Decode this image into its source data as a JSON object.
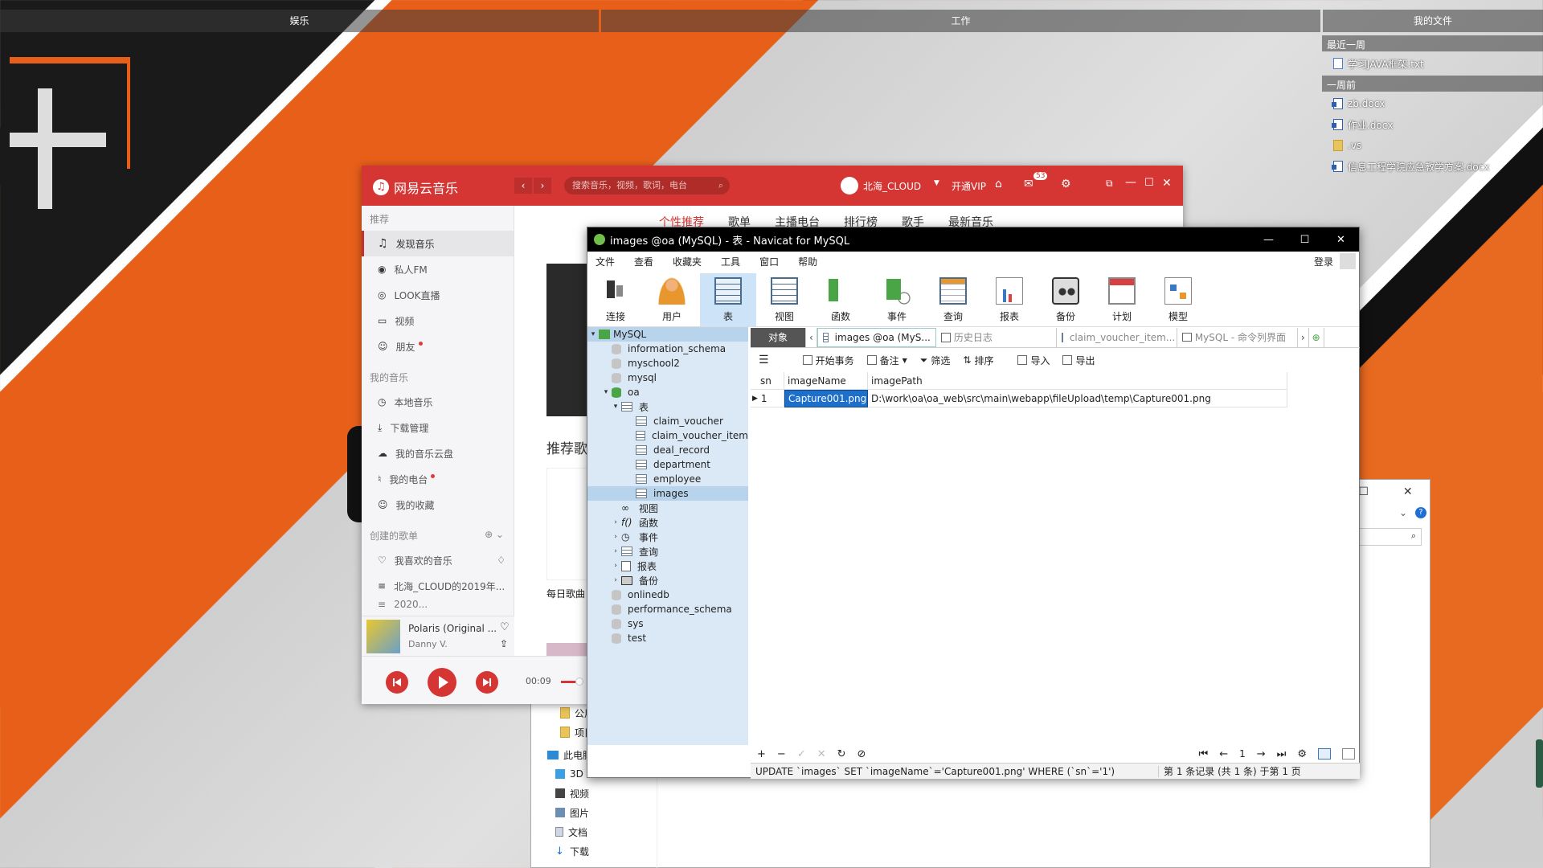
{
  "desktop": {
    "fences": [
      "娱乐",
      "工作",
      "我的文件"
    ],
    "recent": {
      "header1": "最近一周",
      "items1": [
        "学习JAVA框架.txt"
      ],
      "header2": "一周前",
      "items2": [
        "zb.docx",
        "作业.docx",
        ".vs",
        "信息工程学院应急教学方案.docx"
      ]
    }
  },
  "explorer": {
    "items": [
      "公用",
      "项目",
      "此电脑",
      "3D",
      "视频",
      "图片",
      "文档",
      "下载"
    ]
  },
  "netease": {
    "brand": "网易云音乐",
    "search_placeholder": "搜索音乐，视频，歌词，电台",
    "user": "北海_CLOUD",
    "vip": "开通VIP",
    "mail_count": "53",
    "tabs": [
      "个性推荐",
      "歌单",
      "主播电台",
      "排行榜",
      "歌手",
      "最新音乐"
    ],
    "sec_recommend": "推荐",
    "recommend_items": [
      "发现音乐",
      "私人FM",
      "LOOK直播",
      "视频",
      "朋友"
    ],
    "sec_mine": "我的音乐",
    "mine_items": [
      "本地音乐",
      "下载管理",
      "我的音乐云盘",
      "我的电台",
      "我的收藏"
    ],
    "sec_created": "创建的歌单",
    "created_items": [
      "我喜欢的音乐",
      "北海_CLOUD的2019年...",
      "2020..."
    ],
    "content_heading": "推荐歌",
    "content_label": "每日歌曲",
    "now_title": "Polaris (Original ...",
    "now_artist": "Danny V.",
    "time": "00:09"
  },
  "navicat": {
    "title": "images @oa (MySQL) - 表 - Navicat for MySQL",
    "menu": [
      "文件",
      "查看",
      "收藏夹",
      "工具",
      "窗口",
      "帮助"
    ],
    "login": "登录",
    "tools": [
      "连接",
      "用户",
      "表",
      "视图",
      "函数",
      "事件",
      "查询",
      "报表",
      "备份",
      "计划",
      "模型"
    ],
    "tree": {
      "root": "MySQL",
      "dbs_before": [
        "information_schema",
        "myschool2",
        "mysql"
      ],
      "oa": "oa",
      "tables_node": "表",
      "tables": [
        "claim_voucher",
        "claim_voucher_item",
        "deal_record",
        "department",
        "employee",
        "images"
      ],
      "nodes": [
        "视图",
        "函数",
        "事件",
        "查询",
        "报表",
        "备份"
      ],
      "dbs_after": [
        "onlinedb",
        "performance_schema",
        "sys",
        "test"
      ]
    },
    "tabs": [
      "对象",
      "images @oa (MyS...",
      "历史日志",
      "claim_voucher_item...",
      "MySQL - 命令列界面"
    ],
    "subtools": [
      "开始事务",
      "备注",
      "筛选",
      "排序",
      "导入",
      "导出"
    ],
    "columns": [
      "sn",
      "imageName",
      "imagePath"
    ],
    "row": {
      "sn": "1",
      "imageName": "Capture001.png",
      "imagePath": "D:\\work\\oa\\oa_web\\src\\main\\webapp\\fileUpload\\temp\\Capture001.png"
    },
    "page": "1",
    "sql": "UPDATE `images` SET `imageName`='Capture001.png' WHERE (`sn`='1')",
    "records": "第 1 条记录 (共 1 条) 于第 1 页"
  }
}
